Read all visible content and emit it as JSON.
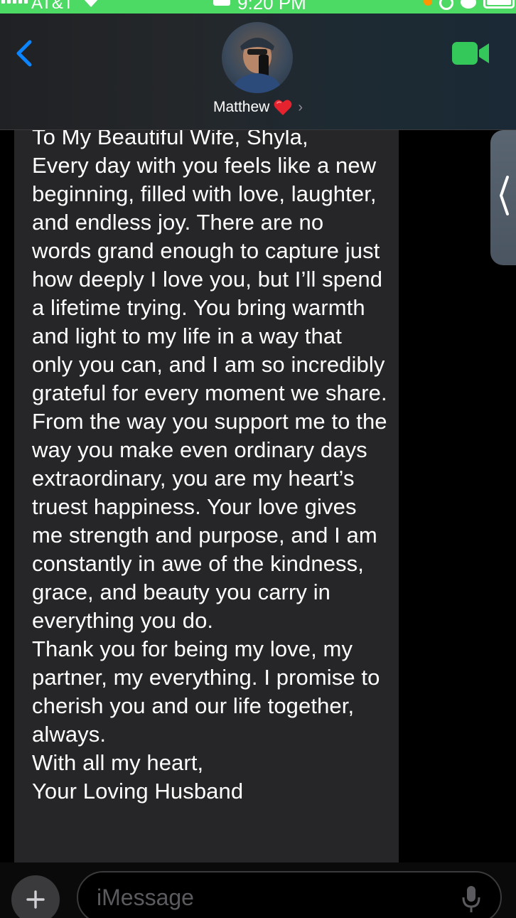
{
  "status_bar": {
    "carrier": "AT&T",
    "time": "9:20 PM",
    "bg_color": "#4cd964"
  },
  "header": {
    "contact_name": "Matthew",
    "contact_emoji": "❤️",
    "chevron": "›",
    "back_icon": "chevron-left-icon",
    "video_icon": "facetime-video-icon",
    "accent_color": "#0a84ff",
    "facetime_color": "#34c759"
  },
  "message": {
    "text": "To My Beautiful Wife, Shyla,\nEvery day with you feels like a new beginning, filled with love, laughter, and endless joy. There are no words grand enough to capture just how deeply I love you, but I’ll spend a lifetime trying. You bring warmth and light to my life in a way that only you can, and I am so incredibly grateful for every moment we share.\nFrom the way you support me to the way you make even ordinary days extraordinary, you are my heart’s truest happiness. Your love gives me strength and purpose, and I am constantly in awe of the kindness, grace, and beauty you carry in everything you do.\nThank you for being my love, my partner, my everything. I promise to cherish you and our life together, always.\nWith all my heart,\nYour Loving Husband",
    "bubble_color": "#262628"
  },
  "input": {
    "placeholder": "iMessage",
    "plus_icon": "plus-icon",
    "mic_icon": "microphone-icon"
  }
}
